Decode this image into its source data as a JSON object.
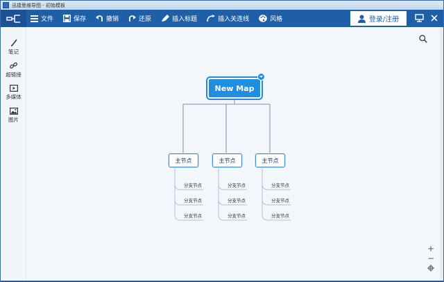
{
  "window": {
    "title": "迅捷思维导图 - 初始模板"
  },
  "toolbar": {
    "items": [
      {
        "label": "文件",
        "icon": "menu-list-icon"
      },
      {
        "label": "保存",
        "icon": "save-icon"
      },
      {
        "label": "撤销",
        "icon": "undo-icon"
      },
      {
        "label": "还原",
        "icon": "redo-icon"
      },
      {
        "label": "插入标题",
        "icon": "insert-title-icon"
      },
      {
        "label": "插入关连线",
        "icon": "insert-link-line-icon"
      },
      {
        "label": "风格",
        "icon": "palette-icon"
      }
    ],
    "login_label": "登录/注册"
  },
  "sidebar": {
    "items": [
      {
        "label": "笔记",
        "icon": "pencil-icon"
      },
      {
        "label": "超链接",
        "icon": "link-icon"
      },
      {
        "label": "多媒体",
        "icon": "media-icon"
      },
      {
        "label": "图片",
        "icon": "image-icon"
      }
    ]
  },
  "mindmap": {
    "root": "New Map",
    "main_nodes": [
      {
        "label": "主节点",
        "children": [
          "分支节点",
          "分支节点",
          "分支节点"
        ]
      },
      {
        "label": "主节点",
        "children": [
          "分支节点",
          "分支节点",
          "分支节点"
        ]
      },
      {
        "label": "主节点",
        "children": [
          "分支节点",
          "分支节点",
          "分支节点"
        ]
      }
    ]
  },
  "zoom": {
    "plus": "+",
    "minus": "−"
  },
  "colors": {
    "toolbar": "#1f5fa8",
    "node": "#1f8de0",
    "canvas": "#f3f7fc"
  }
}
